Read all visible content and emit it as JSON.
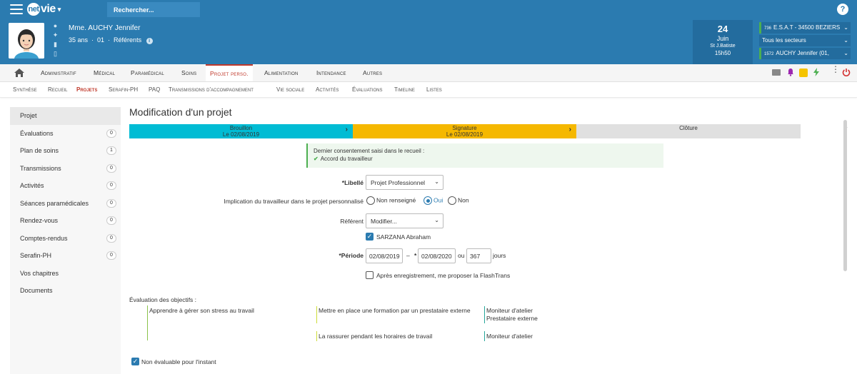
{
  "topbar": {
    "logo_prefix": "net",
    "logo_suffix": "vie",
    "search_label": "Rechercher...",
    "help_label": "?"
  },
  "patient": {
    "name": "Mme. AUCHY Jennifer",
    "age": "35 ans",
    "number": "01",
    "referents": "Référents",
    "date_day": "24",
    "date_month": "Juin",
    "date_saint": "St J.Batiste",
    "date_time": "15h50",
    "select_establishment_code": "736",
    "select_establishment": "E.S.A.T - 34500 BEZIERS",
    "select_sector": "Tous les secteurs",
    "select_user_code": "1572",
    "select_user": "AUCHY Jennifer (01,"
  },
  "mainnav": {
    "items": [
      "Administratif",
      "Médical",
      "Paramédical",
      "Soins",
      "Projet perso.",
      "Alimentation",
      "Intendance",
      "Autres"
    ]
  },
  "subnav": {
    "items": [
      "Synthèse",
      "Recueil",
      "Projets",
      "Serafin-PH",
      "PAQ",
      "Transmissions d'accompagnement",
      "Vie sociale",
      "Activités",
      "Évaluations",
      "Timeline",
      "Listes"
    ]
  },
  "sidebar": {
    "items": [
      {
        "label": "Projet",
        "count": ""
      },
      {
        "label": "Évaluations",
        "count": "0"
      },
      {
        "label": "Plan de soins",
        "count": "1"
      },
      {
        "label": "Transmissions",
        "count": "0"
      },
      {
        "label": "Activités",
        "count": "0"
      },
      {
        "label": "Séances paramédicales",
        "count": "0"
      },
      {
        "label": "Rendez-vous",
        "count": "0"
      },
      {
        "label": "Comptes-rendus",
        "count": "0"
      },
      {
        "label": "Serafin-PH",
        "count": "0"
      },
      {
        "label": "Vos chapitres",
        "count": ""
      },
      {
        "label": "Documents",
        "count": ""
      }
    ]
  },
  "content": {
    "title": "Modification d'un projet",
    "steps": [
      {
        "name": "Brouillon",
        "date": "Le 02/08/2019",
        "color": "#00bcd4"
      },
      {
        "name": "Signature",
        "date": "Le 02/08/2019",
        "color": "#f5b800"
      },
      {
        "name": "Clôture",
        "date": "",
        "color": "#e0e0e0"
      }
    ],
    "consent_title": "Dernier consentement saisi dans le recueil :",
    "consent_value": "Accord du travailleur",
    "libelle_label": "*Libellé",
    "libelle_value": "Projet Professionnel",
    "implication_label": "Implication du travailleur dans le projet personnalisé",
    "implication_options": [
      "Non renseigné",
      "Oui",
      "Non"
    ],
    "referent_label": "Référent",
    "referent_value": "Modifier...",
    "referent_person": "SARZANA Abraham",
    "periode_label": "*Période",
    "periode_start": "02/08/2019",
    "periode_dash": "–",
    "periode_star": "*",
    "periode_end": "02/08/2020",
    "periode_or": "ou",
    "periode_days": "367",
    "periode_unit": "jours",
    "flashtrans_label": "Après enregistrement, me proposer la FlashTrans",
    "objectives_label": "Évaluation des objectifs :",
    "objective_1": "Apprendre à gérer son stress au travail",
    "action_1": "Mettre en place une formation par un prestataire externe",
    "who_1a": "Moniteur d'atelier",
    "who_1b": "Prestataire externe",
    "action_2": "La rassurer pendant les horaires de travail",
    "who_2": "Moniteur d'atelier",
    "non_evaluable_label": "Non évaluable pour l'instant"
  }
}
